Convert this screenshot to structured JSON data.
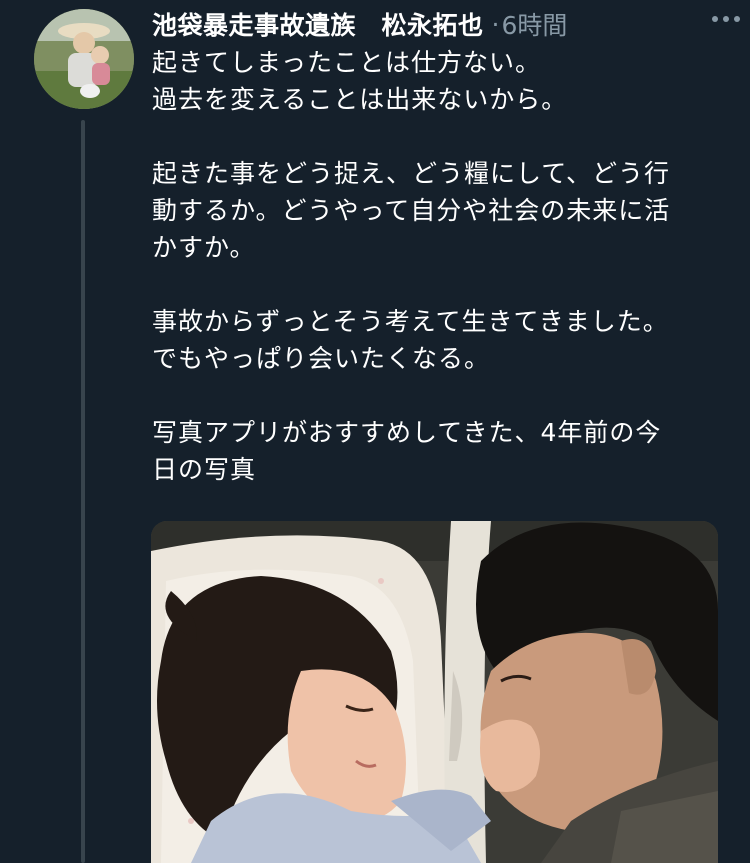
{
  "tweet": {
    "display_name": "池袋暴走事故遺族　松永拓也",
    "separator": "·",
    "timestamp": "6時間",
    "more_icon": "more-horizontal-icon",
    "lines": {
      "l1": "起きてしまったことは仕方ない。",
      "l2": "過去を変えることは出来ないから。",
      "l3": "起きた事をどう捉え、どう糧にして、どう行",
      "l4": "動するか。どうやって自分や社会の未来に活",
      "l5": "かすか。",
      "l6": "事故からずっとそう考えて生きてきました。",
      "l7": "でもやっぱり会いたくなる。",
      "l8": "写真アプリがおすすめしてきた、4年前の今",
      "l9": "日の写真"
    }
  },
  "colors": {
    "background": "#15202b",
    "text_primary": "#ffffff",
    "text_secondary": "#8899a6",
    "thread_line": "#38444d"
  }
}
